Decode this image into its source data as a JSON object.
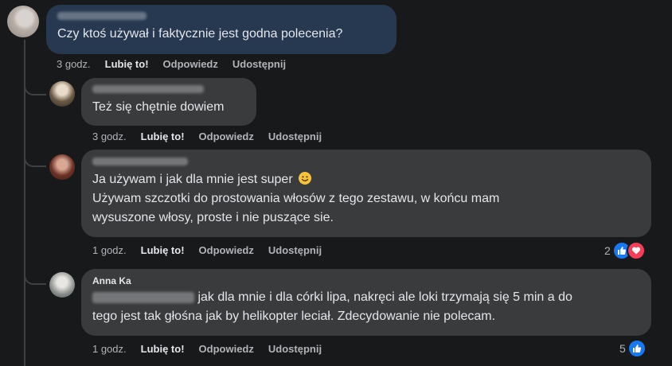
{
  "comments": [
    {
      "text": "Czy ktoś używał i faktycznie jest godna polecenia?",
      "time": "3 godz.",
      "like": "Lubię to!",
      "reply": "Odpowiedz",
      "share": "Udostępnij"
    },
    {
      "text": "Też się chętnie dowiem",
      "time": "3 godz.",
      "like": "Lubię to!",
      "reply": "Odpowiedz",
      "share": "Udostępnij"
    },
    {
      "text_line1": "Ja używam i jak dla mnie jest super",
      "text_line2": "Używam szczotki do prostowania włosów z tego zestawu, w końcu mam",
      "text_line3": "wysuszone włosy, proste i nie puszące sie.",
      "time": "1 godz.",
      "like": "Lubię to!",
      "reply": "Odpowiedz",
      "share": "Udostępnij",
      "reaction_count": "2"
    },
    {
      "author": "Anna Ka",
      "text_line1": " jak dla mnie i dla córki lipa, nakręci ale loki trzymają się 5 min a do",
      "text_line2": "tego jest tak głośna jak by helikopter leciał. Zdecydowanie nie polecam.",
      "time": "1 godz.",
      "like": "Lubię to!",
      "reply": "Odpowiedz",
      "share": "Udostępnij",
      "reaction_count": "5"
    }
  ],
  "colors": {
    "background": "#18191a",
    "main_bubble": "#263951",
    "reply_bubble": "#3a3b3c",
    "like_blue": "#1877f2",
    "love_red": "#f33e58"
  }
}
